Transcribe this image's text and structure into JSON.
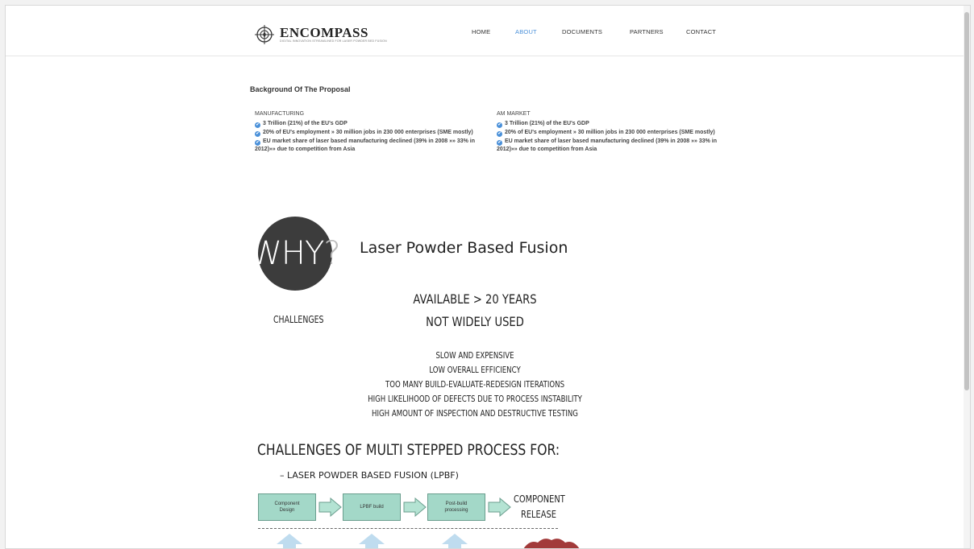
{
  "header": {
    "logo": {
      "name": "ENCOMPASS",
      "tagline": "DIGITAL INNOVATION STREAMLINED FOR LASER POWDER BED FUSION"
    },
    "nav": [
      {
        "label": "HOME",
        "active": false
      },
      {
        "label": "ABOUT",
        "active": true
      },
      {
        "label": "DOCUMENTS",
        "active": false
      },
      {
        "label": "PARTNERS",
        "active": false
      },
      {
        "label": "CONTACT",
        "active": false
      }
    ]
  },
  "main": {
    "title": "Background Of The Proposal",
    "columns": [
      {
        "heading": "MANUFACTURING",
        "items": [
          "3 Trillion (21%) of the EU's GDP",
          "20% of EU's employment » 30 million jobs in 230 000 enterprises (SME mostly)",
          "EU market share of laser based manufacturing declined (39% in 2008 »» 33% in 2012)»» due to competition from Asia"
        ]
      },
      {
        "heading": "AM MARKET",
        "items": [
          "3 Trillion (21%) of the EU's GDP",
          "20% of EU's employment » 30 million jobs in 230 000 enterprises (SME mostly)",
          "EU market share of laser based manufacturing declined (39% in 2008 »» 33% in 2012)»» due to competition from Asia"
        ]
      }
    ]
  },
  "infographic": {
    "why": "WHY",
    "why_q": "?",
    "subject": "Laser Powder Based Fusion",
    "challenges_label": "CHALLENGES",
    "available": "AVAILABLE > 20 YEARS",
    "not_used": "NOT WIDELY USED",
    "issues": [
      "SLOW AND EXPENSIVE",
      "LOW OVERALL EFFICIENCY",
      "TOO MANY BUILD-EVALUATE-REDESIGN ITERATIONS",
      "HIGH LIKELIHOOD OF DEFECTS DUE TO PROCESS INSTABILITY",
      "HIGH AMOUNT OF INSPECTION AND DESTRUCTIVE TESTING"
    ],
    "process_heading": "CHALLENGES OF MULTI STEPPED PROCESS FOR:",
    "process_sub": "–   LASER POWDER BASED FUSION (LPBF)",
    "steps": [
      "Component Design",
      "LPBF build",
      "Post-build processing"
    ],
    "release": [
      "COMPONENT",
      "RELEASE"
    ],
    "colors": {
      "step_fill": "#a3d8c8",
      "arrow_fill": "#b4e3d3",
      "up_arrow": "#bfdcef",
      "accent": "#4a90d9"
    }
  }
}
